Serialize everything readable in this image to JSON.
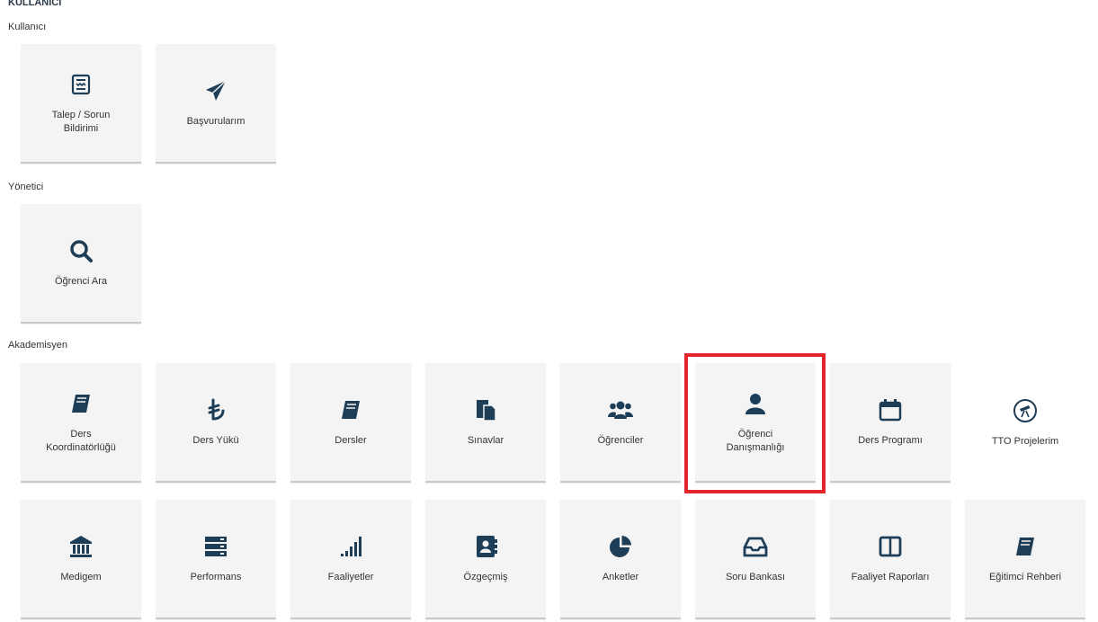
{
  "header": {
    "title": "KULLANICI"
  },
  "colors": {
    "icon": "#1e3d57",
    "highlight": "#e5242b",
    "tile_bg": "#f4f4f4"
  },
  "sections": {
    "kullanici": {
      "title": "Kullanıcı",
      "tiles": [
        {
          "label": "Talep / Sorun Bildirimi",
          "icon": "form-icon"
        },
        {
          "label": "Başvurularım",
          "icon": "paper-plane-icon"
        }
      ]
    },
    "yonetici": {
      "title": "Yönetici",
      "tiles": [
        {
          "label": "Öğrenci Ara",
          "icon": "search-icon"
        }
      ]
    },
    "akademisyen": {
      "title": "Akademisyen",
      "tiles": [
        {
          "label": "Ders Koordinatörlüğü",
          "icon": "book-icon"
        },
        {
          "label": "Ders Yükü",
          "icon": "lira-icon"
        },
        {
          "label": "Dersler",
          "icon": "book-icon"
        },
        {
          "label": "Sınavlar",
          "icon": "documents-icon"
        },
        {
          "label": "Öğrenciler",
          "icon": "users-icon"
        },
        {
          "label": "Öğrenci Danışmanlığı",
          "icon": "user-icon"
        },
        {
          "label": "Ders Programı",
          "icon": "calendar-icon"
        },
        {
          "label": "TTO Projelerim",
          "icon": "telescope-icon"
        },
        {
          "label": "Medigem",
          "icon": "bank-icon"
        },
        {
          "label": "Performans",
          "icon": "server-icon"
        },
        {
          "label": "Faaliyetler",
          "icon": "signal-icon"
        },
        {
          "label": "Özgeçmiş",
          "icon": "contact-book-icon"
        },
        {
          "label": "Anketler",
          "icon": "pie-chart-icon"
        },
        {
          "label": "Soru Bankası",
          "icon": "inbox-icon"
        },
        {
          "label": "Faaliyet Raporları",
          "icon": "columns-icon"
        },
        {
          "label": "Eğitimci Rehberi",
          "icon": "book-icon"
        }
      ]
    }
  }
}
